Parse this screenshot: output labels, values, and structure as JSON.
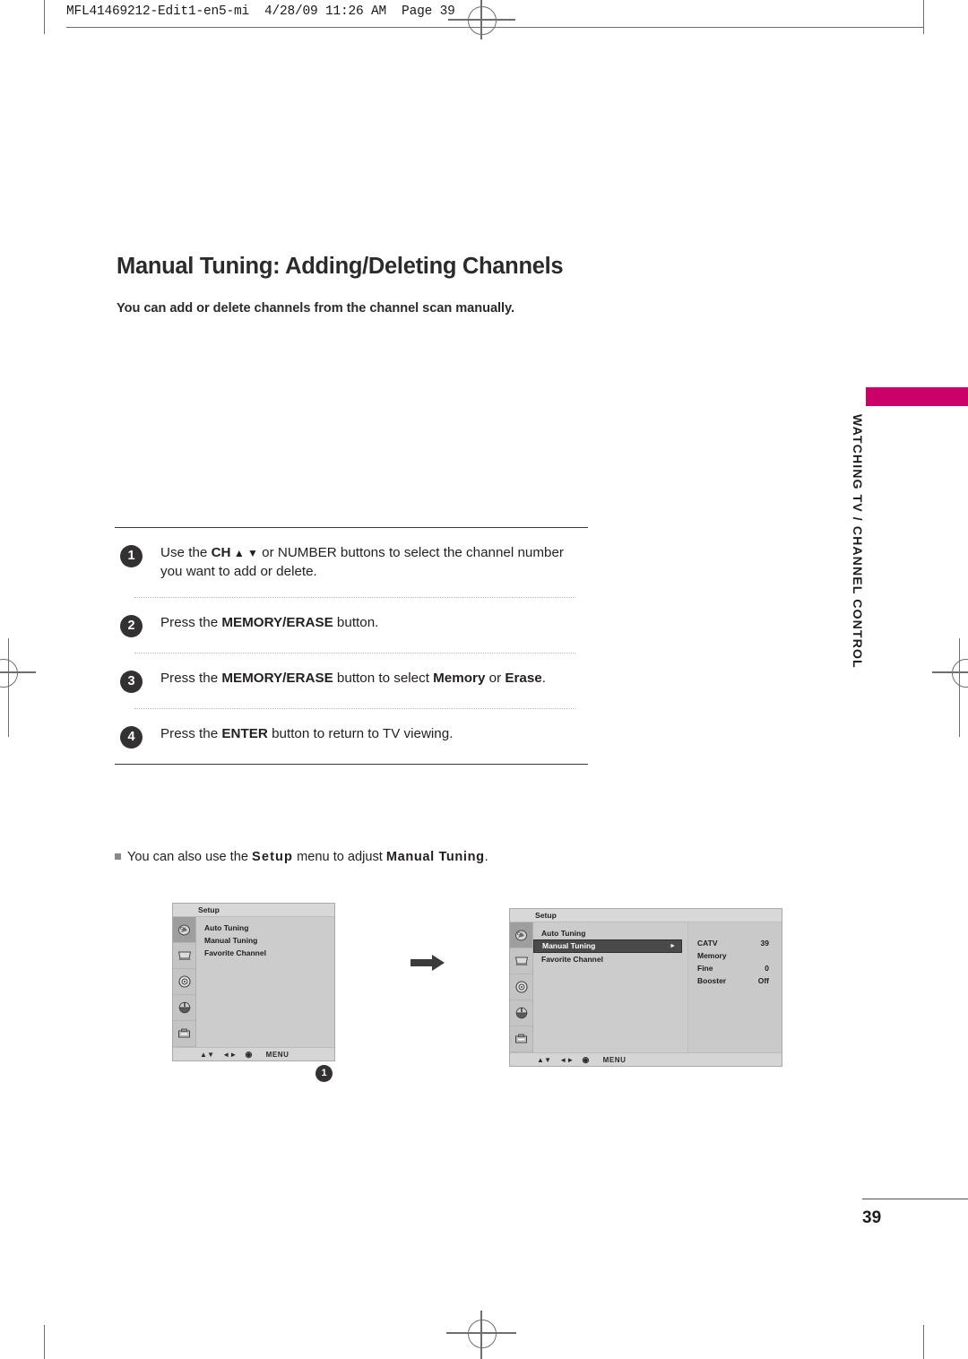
{
  "slug": "MFL41469212-Edit1-en5-mi  4/28/09 11:26 AM  Page 39",
  "page": {
    "title": "Manual Tuning: Adding/Deleting Channels",
    "subtitle": "You can add or delete channels from the channel scan manually.",
    "number": "39"
  },
  "side_tab": {
    "label": "WATCHING TV / CHANNEL CONTROL",
    "accent_color": "#cc0069"
  },
  "steps": [
    {
      "number": "1",
      "parts": [
        {
          "text": "Use the ",
          "bold": false
        },
        {
          "text": "CH",
          "bold": true
        },
        {
          "text": " ▲ ▼",
          "bold": true
        },
        {
          "text": " or NUMBER buttons to select the channel number you want to add or delete.",
          "bold": false
        }
      ]
    },
    {
      "number": "2",
      "parts": [
        {
          "text": "Press the ",
          "bold": false
        },
        {
          "text": "MEMORY/ERASE",
          "bold": true
        },
        {
          "text": " button.",
          "bold": false
        }
      ]
    },
    {
      "number": "3",
      "parts": [
        {
          "text": "Press the ",
          "bold": false
        },
        {
          "text": "MEMORY/ERASE",
          "bold": true
        },
        {
          "text": " button to select ",
          "bold": false
        },
        {
          "text": "Memory",
          "bold": true
        },
        {
          "text": " or ",
          "bold": false
        },
        {
          "text": "Erase",
          "bold": true
        },
        {
          "text": ".",
          "bold": false
        }
      ]
    },
    {
      "number": "4",
      "parts": [
        {
          "text": "Press the ",
          "bold": false
        },
        {
          "text": "ENTER",
          "bold": true
        },
        {
          "text": " button to return to TV viewing.",
          "bold": false
        }
      ]
    }
  ],
  "note": {
    "lead": "You can also use the ",
    "setup_word": "Setup",
    "mid": " menu to adjust ",
    "target_word": "Manual Tuning",
    "end": "."
  },
  "osd": {
    "title": "Setup",
    "footer": {
      "updown": "▲▼",
      "leftright": "◄►",
      "enter": "◉",
      "menu": "MENU"
    },
    "rail_icons": [
      "channel-setup-icon",
      "picture-icon",
      "audio-icon",
      "time-icon",
      "option-lock-icon"
    ],
    "screen1": {
      "menu_items": [
        {
          "label": "Auto Tuning",
          "selected": false
        },
        {
          "label": "Manual Tuning",
          "selected": false
        },
        {
          "label": "Favorite Channel",
          "selected": false
        }
      ],
      "callout": "1"
    },
    "screen2": {
      "menu_items": [
        {
          "label": "Auto Tuning",
          "selected": false
        },
        {
          "label": "Manual Tuning",
          "selected": true
        },
        {
          "label": "Favorite Channel",
          "selected": false
        }
      ],
      "caret": "►",
      "settings": [
        {
          "label": "CATV",
          "value": "39"
        },
        {
          "label": "Memory",
          "value": ""
        },
        {
          "label": "Fine",
          "value": "0"
        },
        {
          "label": "Booster",
          "value": "Off"
        }
      ]
    }
  }
}
